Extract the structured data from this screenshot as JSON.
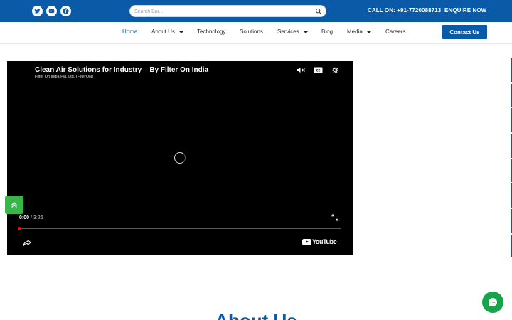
{
  "header": {
    "social": [
      {
        "icon": "twitter-icon"
      },
      {
        "icon": "youtube-icon"
      },
      {
        "icon": "facebook-icon"
      }
    ],
    "search": {
      "placeholder": "Search Bar...",
      "value": ""
    },
    "call_label": "CALL ON: +91-7720088713",
    "enquire_label": "ENQUIRE NOW"
  },
  "nav": {
    "items": [
      {
        "label": "Home",
        "active": true,
        "dropdown": false
      },
      {
        "label": "About Us",
        "active": false,
        "dropdown": true
      },
      {
        "label": "Technology",
        "active": false,
        "dropdown": false
      },
      {
        "label": "Solutions",
        "active": false,
        "dropdown": false
      },
      {
        "label": "Services",
        "active": false,
        "dropdown": true
      },
      {
        "label": "Blog",
        "active": false,
        "dropdown": false
      },
      {
        "label": "Media",
        "active": false,
        "dropdown": true
      },
      {
        "label": "Careers",
        "active": false,
        "dropdown": false
      }
    ],
    "contact_label": "Contact Us"
  },
  "video": {
    "title": "Clean Air Solutions for Industry – By Filter On India",
    "channel": "Filter On India Pvt. Ltd. (FilterON)",
    "current_time": "0:00",
    "separator": "/",
    "duration": "3:26",
    "progress": 0,
    "brand": "YouTube"
  },
  "about": {
    "heading": "About Us"
  },
  "colors": {
    "brand_blue": "#0b5aa8",
    "scroll_green": "#39b54a",
    "chat_green": "#17a34a",
    "progress_red": "#ff0000"
  }
}
